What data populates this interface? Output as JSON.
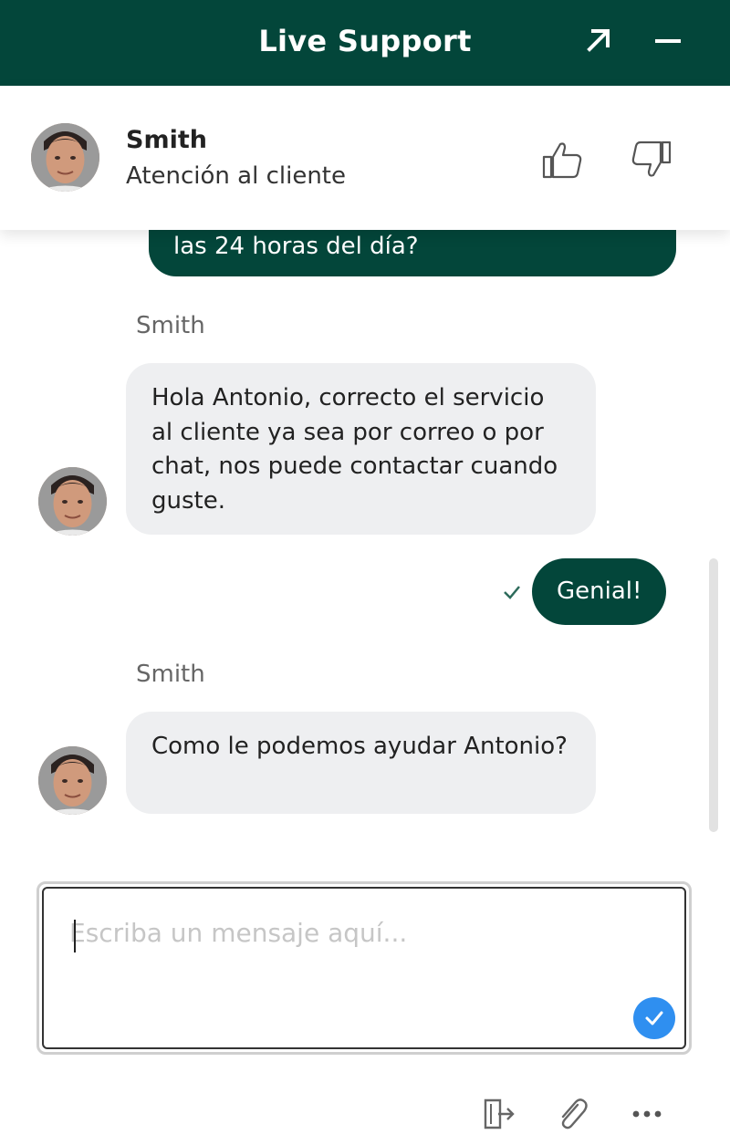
{
  "window": {
    "title": "Live Support",
    "icons": {
      "expand": "expand-arrow-icon",
      "minimize": "minimize-icon"
    },
    "colors": {
      "header_bg": "#03463a",
      "outgoing_bubble": "#03463a",
      "incoming_bubble": "#eeeff1",
      "send_button": "#2f8ff0"
    }
  },
  "agent": {
    "name": "Smith",
    "role": "Atención al cliente",
    "rating_icons": [
      "thumbs-up-icon",
      "thumbs-down-icon"
    ]
  },
  "messages": [
    {
      "direction": "outgoing",
      "text": "las 24 horas del día?"
    },
    {
      "direction": "incoming",
      "sender": "Smith",
      "text": "Hola Antonio, correcto el servicio al cliente ya sea por correo o por chat, nos puede contactar cuando guste."
    },
    {
      "direction": "outgoing",
      "text": "Genial!",
      "status_icon": "check-icon"
    },
    {
      "direction": "incoming",
      "sender": "Smith",
      "text": "Como le podemos ayudar Antonio?"
    }
  ],
  "composer": {
    "placeholder": "Escriba un mensaje aquí...",
    "value": "",
    "send_icon": "check-icon"
  },
  "toolbar": {
    "icons": [
      "exit-icon",
      "paperclip-icon",
      "more-dots-icon"
    ]
  }
}
